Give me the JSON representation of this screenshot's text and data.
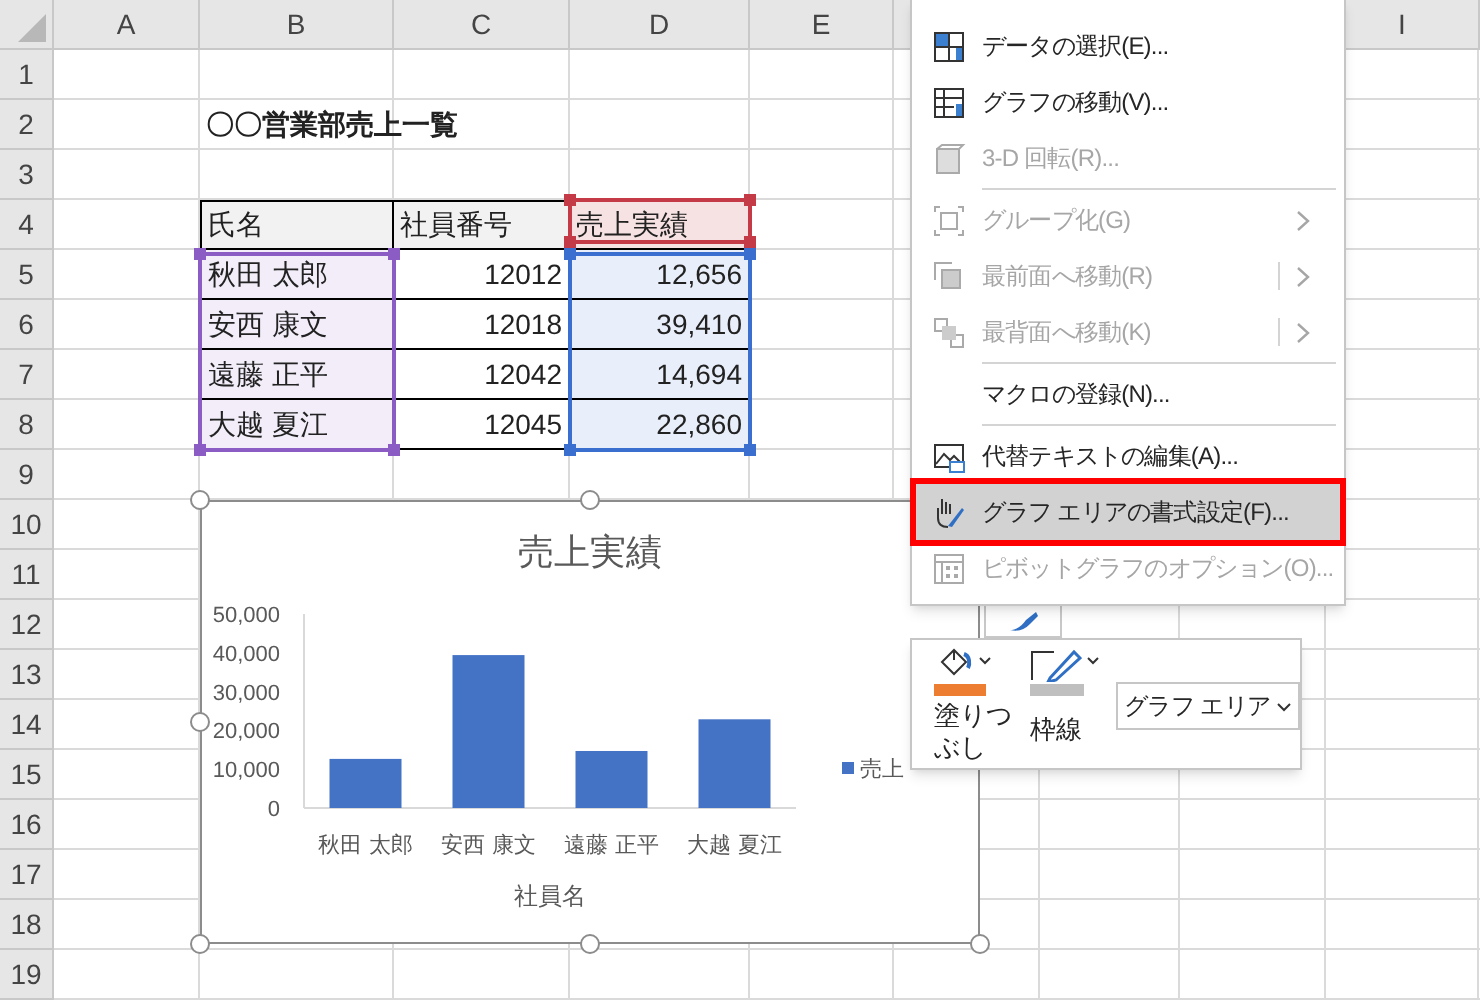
{
  "sheet": {
    "column_headers": [
      "A",
      "B",
      "C",
      "D",
      "E"
    ],
    "right_column_headers": [
      "I"
    ],
    "row_headers": [
      "1",
      "2",
      "3",
      "4",
      "5",
      "6",
      "7",
      "8",
      "9",
      "10",
      "11",
      "12",
      "13",
      "14",
      "15",
      "16",
      "17",
      "18",
      "19"
    ],
    "title": "〇〇営業部売上一覧",
    "table": {
      "columns": [
        {
          "header": "氏名",
          "kind": "text",
          "body_range": {
            "color": "#8a5cc4"
          }
        },
        {
          "header": "社員番号",
          "kind": "number"
        },
        {
          "header": "売上実績",
          "kind": "number",
          "header_range": {
            "color": "#c43a46"
          },
          "body_range": {
            "color": "#3a6fd0"
          }
        }
      ],
      "rows": [
        [
          "秋田 太郎",
          "12012",
          "12,656"
        ],
        [
          "安西 康文",
          "12018",
          "39,410"
        ],
        [
          "遠藤 正平",
          "12042",
          "14,694"
        ],
        [
          "大越 夏江",
          "12045",
          "22,860"
        ]
      ]
    }
  },
  "chart": {
    "chart_data": {
      "type": "bar",
      "title": "売上実績",
      "xlabel": "社員名",
      "categories": [
        "秋田 太郎",
        "安西 康文",
        "遠藤 正平",
        "大越 夏江"
      ],
      "series": [
        {
          "name": "売上",
          "color": "#4472c4",
          "values": [
            12656,
            39410,
            14694,
            22860
          ]
        }
      ],
      "ylim": [
        0,
        50000
      ],
      "yticks": [
        {
          "value": 0,
          "label": "0"
        },
        {
          "value": 10000,
          "label": "10,000"
        },
        {
          "value": 20000,
          "label": "20,000"
        },
        {
          "value": 30000,
          "label": "30,000"
        },
        {
          "value": 40000,
          "label": "40,000"
        },
        {
          "value": 50000,
          "label": "50,000"
        }
      ]
    }
  },
  "context_menu": {
    "items": [
      {
        "kind": "item",
        "label": "データの選択(E)...",
        "disabled": false,
        "submenu": false,
        "split": false,
        "highlighted": false,
        "callout": false
      },
      {
        "kind": "item",
        "label": "グラフの移動(V)...",
        "disabled": false,
        "submenu": false,
        "split": false,
        "highlighted": false,
        "callout": false
      },
      {
        "kind": "item",
        "label": "3-D 回転(R)...",
        "disabled": true,
        "submenu": false,
        "split": false,
        "highlighted": false,
        "callout": false
      },
      {
        "kind": "separator"
      },
      {
        "kind": "item",
        "label": "グループ化(G)",
        "disabled": true,
        "submenu": true,
        "split": false,
        "highlighted": false,
        "callout": false
      },
      {
        "kind": "item",
        "label": "最前面へ移動(R)",
        "disabled": true,
        "submenu": true,
        "split": true,
        "highlighted": false,
        "callout": false
      },
      {
        "kind": "item",
        "label": "最背面へ移動(K)",
        "disabled": true,
        "submenu": true,
        "split": true,
        "highlighted": false,
        "callout": false
      },
      {
        "kind": "separator"
      },
      {
        "kind": "item",
        "label": "マクロの登録(N)...",
        "disabled": false,
        "submenu": false,
        "split": false,
        "highlighted": false,
        "callout": false
      },
      {
        "kind": "separator"
      },
      {
        "kind": "item",
        "label": "代替テキストの編集(A)...",
        "disabled": false,
        "submenu": false,
        "split": false,
        "highlighted": false,
        "callout": false
      },
      {
        "kind": "item",
        "label": "グラフ エリアの書式設定(F)...",
        "disabled": false,
        "submenu": false,
        "split": false,
        "highlighted": true,
        "callout": true
      },
      {
        "kind": "item",
        "label": "ピボットグラフのオプション(O)...",
        "disabled": true,
        "submenu": false,
        "split": false,
        "highlighted": false,
        "callout": false
      }
    ]
  },
  "mini_toolbar": {
    "buttons": [
      {
        "kind": "fill",
        "label": "塗りつぶし",
        "color": "#ed7d31"
      },
      {
        "kind": "outline",
        "label": "枠線",
        "color": "#bfbfbf"
      }
    ],
    "dropdown": {
      "value": "グラフ エリア"
    }
  }
}
